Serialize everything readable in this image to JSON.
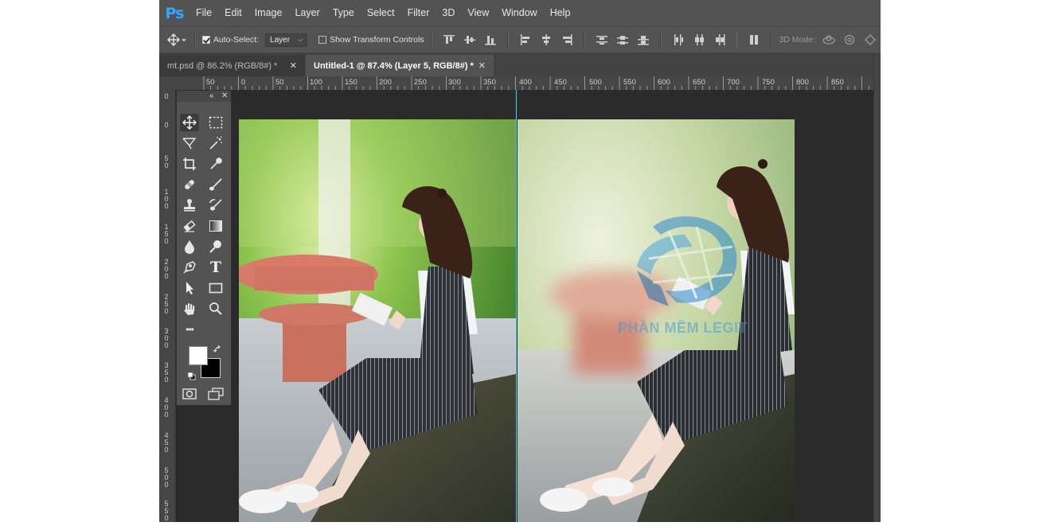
{
  "app": {
    "logo": "Ps",
    "menu": [
      "File",
      "Edit",
      "Image",
      "Layer",
      "Type",
      "Select",
      "Filter",
      "3D",
      "View",
      "Window",
      "Help"
    ]
  },
  "options_bar": {
    "auto_select_label": "Auto-Select:",
    "auto_select_checked": true,
    "layer_option": "Layer",
    "show_transform_label": "Show Transform Controls",
    "show_transform_checked": false,
    "mode_3d_label": "3D Mode:"
  },
  "tabs": [
    {
      "label": "mt.psd @ 86.2% (RGB/8#) *",
      "active": false
    },
    {
      "label": "Untitled-1 @ 87.4% (Layer 5, RGB/8#) *",
      "active": true
    }
  ],
  "ruler": {
    "h_labels": [
      "50",
      "0",
      "50",
      "100",
      "150",
      "200",
      "250",
      "300",
      "350",
      "400",
      "450",
      "500",
      "550",
      "600",
      "650",
      "700",
      "750",
      "800",
      "850"
    ],
    "v_labels": [
      "0",
      "0",
      "5\n0",
      "1\n0\n0",
      "1\n5\n0",
      "2\n0\n0",
      "2\n5\n0",
      "3\n0\n0",
      "3\n5\n0",
      "4\n0\n0",
      "4\n5\n0",
      "5\n0\n0",
      "5\n5\n0"
    ]
  },
  "tools": {
    "move": "move-tool-icon",
    "marquee": "marquee-tool-icon",
    "lasso": "lasso-tool-icon",
    "magic_wand": "magic-wand-tool-icon",
    "crop": "crop-tool-icon",
    "eyedropper": "eyedropper-tool-icon",
    "healing": "healing-brush-tool-icon",
    "brush": "brush-tool-icon",
    "stamp": "clone-stamp-tool-icon",
    "history_brush": "history-brush-tool-icon",
    "eraser": "eraser-tool-icon",
    "gradient": "gradient-tool-icon",
    "blur": "blur-tool-icon",
    "dodge": "dodge-tool-icon",
    "pen": "pen-tool-icon",
    "type_label": "T",
    "path_select": "path-selection-tool-icon",
    "rectangle": "rectangle-tool-icon",
    "hand": "hand-tool-icon",
    "zoom": "zoom-tool-icon",
    "more_label": "•••"
  },
  "colors": {
    "foreground": "#ffffff",
    "background": "#000000",
    "guide": "#3fd6e0",
    "accent": "#31a8ff"
  },
  "watermark": {
    "text": "PHẦN MỀM LEGIT"
  }
}
